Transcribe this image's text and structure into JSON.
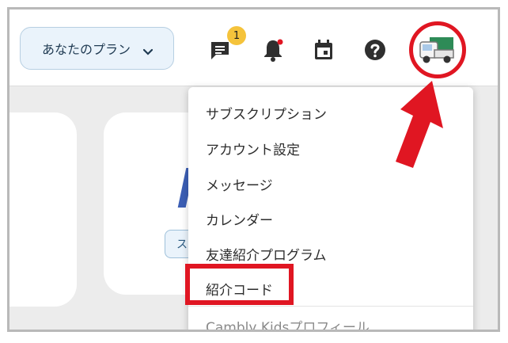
{
  "header": {
    "plan_button": {
      "label": "あなたのプラン",
      "icon": "chevron-down-icon"
    },
    "icons": [
      {
        "name": "chat-icon"
      },
      {
        "name": "bell-icon"
      },
      {
        "name": "calendar-icon"
      },
      {
        "name": "help-icon"
      }
    ],
    "notification_badge": "1",
    "avatar": {
      "name": "truck-avatar"
    }
  },
  "background": {
    "card_pill_text": "ス"
  },
  "menu": {
    "items": [
      "サブスクリプション",
      "アカウント設定",
      "メッセージ",
      "カレンダー",
      "友達紹介プログラム",
      "紹介コード",
      "Cambly Kidsプロフィール"
    ],
    "highlighted_item": "紹介コード"
  },
  "annotation": {
    "arrow_color": "#e01622",
    "highlight_color": "#e01622"
  },
  "colors": {
    "accent": "#1f3a52",
    "badge": "#f5c33b",
    "notification_dot": "#e01622"
  }
}
